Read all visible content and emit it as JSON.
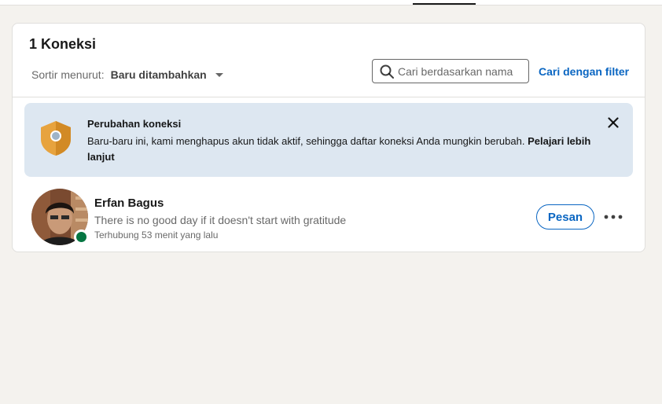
{
  "header": {
    "count_title": "1 Koneksi"
  },
  "sort": {
    "label": "Sortir menurut:",
    "selected": "Baru ditambahkan"
  },
  "search": {
    "placeholder": "Cari berdasarkan nama",
    "value": ""
  },
  "filter_link": "Cari dengan filter",
  "notice": {
    "title": "Perubahan koneksi",
    "body": "Baru-baru ini, kami menghapus akun tidak aktif, sehingga daftar koneksi Anda mungkin berubah.",
    "link": "Pelajari lebih lanjut",
    "icon": "shield-icon",
    "close_icon": "close-icon"
  },
  "connections": [
    {
      "name": "Erfan Bagus",
      "headline": "There is no good day if it doesn't start with gratitude",
      "connected": "Terhubung 53 menit yang lalu",
      "online": true,
      "message_label": "Pesan",
      "more_icon": "more-horizontal-icon"
    }
  ],
  "colors": {
    "page_bg": "#f4f2ee",
    "card_bg": "#ffffff",
    "accent": "#0a66c2",
    "notice_bg": "#dde7f1",
    "shield": "#e7a33e",
    "presence": "#057642"
  }
}
